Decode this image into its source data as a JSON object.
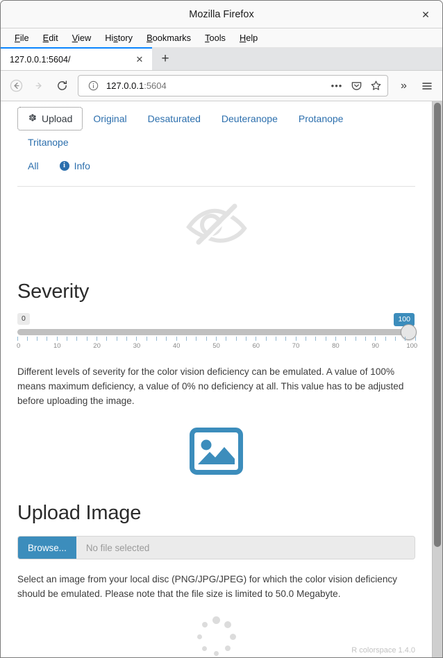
{
  "window": {
    "title": "Mozilla Firefox",
    "close_label": "✕"
  },
  "menubar": {
    "items": [
      {
        "label": "File",
        "accel": "F"
      },
      {
        "label": "Edit",
        "accel": "E"
      },
      {
        "label": "View",
        "accel": "V"
      },
      {
        "label": "History",
        "accel": "s"
      },
      {
        "label": "Bookmarks",
        "accel": "B"
      },
      {
        "label": "Tools",
        "accel": "T"
      },
      {
        "label": "Help",
        "accel": "H"
      }
    ]
  },
  "tabstrip": {
    "tab_title": "127.0.0.1:5604/",
    "tab_close_label": "✕",
    "newtab_label": "+"
  },
  "navbar": {
    "back_icon": "back-arrow-icon",
    "forward_icon": "forward-arrow-icon",
    "reload_icon": "reload-icon",
    "url_host": "127.0.0.1",
    "url_port": ":5604",
    "identity_icon": "info-circle-icon",
    "ellipsis_label": "•••",
    "pocket_icon": "pocket-icon",
    "star_icon": "star-icon",
    "overflow_label": "»",
    "menu_icon": "hamburger-menu-icon"
  },
  "app": {
    "tabs": [
      {
        "label": "Upload",
        "active": true,
        "icon": "gear-icon"
      },
      {
        "label": "Original",
        "active": false
      },
      {
        "label": "Desaturated",
        "active": false
      },
      {
        "label": "Deuteranope",
        "active": false
      },
      {
        "label": "Protanope",
        "active": false
      },
      {
        "label": "Tritanope",
        "active": false
      }
    ],
    "tabs_row2": [
      {
        "label": "All",
        "active": false
      },
      {
        "label": "Info",
        "active": false,
        "icon": "info-circle-icon"
      }
    ],
    "logo_icon": "eye-slash-icon",
    "severity": {
      "heading": "Severity",
      "min_label": "0",
      "value_label": "100",
      "value": 100,
      "min": 0,
      "max": 100,
      "tick_labels": [
        "0",
        "10",
        "20",
        "30",
        "40",
        "50",
        "60",
        "70",
        "80",
        "90",
        "100"
      ],
      "description": "Different levels of severity for the color vision deficiency can be emulated. A value of 100% means maximum deficiency, a value of 0% no deficiency at all. This value has to be adjusted before uploading the image."
    },
    "upload": {
      "image_icon": "picture-placeholder-icon",
      "heading": "Upload Image",
      "browse_label": "Browse...",
      "file_placeholder": "No file selected",
      "description": "Select an image from your local disc (PNG/JPG/JPEG) for which the color vision deficiency should be emulated. Please note that the file size is limited to 50.0 Megabyte."
    },
    "spinner_icon": "loading-spinner-icon",
    "footer": "R colorspace 1.4.0"
  },
  "colors": {
    "accent_blue": "#3c8dbc",
    "link_blue": "#2c6fad",
    "tab_highlight": "#0a84ff",
    "slider_track": "#c0c0c0"
  }
}
